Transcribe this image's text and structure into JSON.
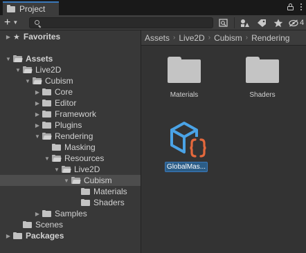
{
  "window": {
    "tab_title": "Project",
    "add_label": "+",
    "hidden_count": "4"
  },
  "search": {
    "value": "",
    "placeholder": ""
  },
  "breadcrumb": [
    "Assets",
    "Live2D",
    "Cubism",
    "Rendering"
  ],
  "tree": [
    {
      "label": "Favorites",
      "bold": true,
      "icon": "star-icon",
      "arrow": "collapsed"
    },
    {
      "label": "Assets",
      "bold": true,
      "icon": "folder-open-icon",
      "arrow": "expanded"
    },
    {
      "label": "Live2D",
      "bold": false,
      "icon": "folder-open-icon",
      "arrow": "expanded"
    },
    {
      "label": "Cubism",
      "bold": false,
      "icon": "folder-open-icon",
      "arrow": "expanded"
    },
    {
      "label": "Core",
      "bold": false,
      "icon": "folder-icon",
      "arrow": "collapsed"
    },
    {
      "label": "Editor",
      "bold": false,
      "icon": "folder-icon",
      "arrow": "collapsed"
    },
    {
      "label": "Framework",
      "bold": false,
      "icon": "folder-icon",
      "arrow": "collapsed"
    },
    {
      "label": "Plugins",
      "bold": false,
      "icon": "folder-icon",
      "arrow": "collapsed"
    },
    {
      "label": "Rendering",
      "bold": false,
      "icon": "folder-open-icon",
      "arrow": "expanded"
    },
    {
      "label": "Masking",
      "bold": false,
      "icon": "folder-icon",
      "arrow": "none"
    },
    {
      "label": "Resources",
      "bold": false,
      "icon": "folder-open-icon",
      "arrow": "expanded"
    },
    {
      "label": "Live2D",
      "bold": false,
      "icon": "folder-open-icon",
      "arrow": "expanded"
    },
    {
      "label": "Cubism",
      "bold": false,
      "icon": "folder-open-icon",
      "arrow": "expanded",
      "selected": true
    },
    {
      "label": "Materials",
      "bold": false,
      "icon": "folder-icon",
      "arrow": "none"
    },
    {
      "label": "Shaders",
      "bold": false,
      "icon": "folder-icon",
      "arrow": "none"
    },
    {
      "label": "Samples",
      "bold": false,
      "icon": "folder-icon",
      "arrow": "collapsed"
    },
    {
      "label": "Scenes",
      "bold": false,
      "icon": "folder-icon",
      "arrow": "none"
    },
    {
      "label": "Packages",
      "bold": true,
      "icon": "folder-icon",
      "arrow": "collapsed"
    }
  ],
  "assets": [
    {
      "label": "Materials",
      "icon": "folder-icon"
    },
    {
      "label": "Shaders",
      "icon": "folder-icon"
    },
    {
      "label": "GlobalMas...",
      "icon": "script-asset-icon",
      "selected": true
    }
  ],
  "colors": {
    "accent": "#3a79bb",
    "selection": "#2c5d87",
    "asset_icon_blue": "#4aa3e6",
    "asset_icon_orange": "#e4683c"
  }
}
